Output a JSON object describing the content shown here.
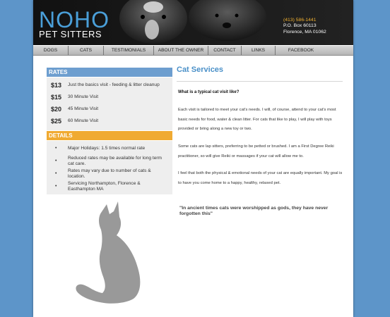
{
  "header": {
    "logo_main": "NOHO",
    "logo_sub": "PET SITTERS",
    "phone": "(413) 586-1441",
    "address_line1": "P.O. Box 60113",
    "address_line2": "Florence, MA 01062"
  },
  "nav": {
    "items": [
      {
        "label": "DOGS"
      },
      {
        "label": "CATS"
      },
      {
        "label": "TESTIMONIALS"
      },
      {
        "label": "ABOUT THE OWNER"
      },
      {
        "label": "CONTACT"
      },
      {
        "label": "LINKS"
      },
      {
        "label": "FACEBOOK"
      }
    ]
  },
  "rates": {
    "heading": "RATES",
    "items": [
      {
        "price": "$13",
        "desc": "Just the basics visit - feeding & litter cleanup"
      },
      {
        "price": "$15",
        "desc": "30 Minute Visit"
      },
      {
        "price": "$20",
        "desc": "45 Minute Visit"
      },
      {
        "price": "$25",
        "desc": "60 Minute Visit"
      }
    ]
  },
  "details": {
    "heading": "DETAILS",
    "bullet": "•",
    "items": [
      {
        "text": "Major Holidays: 1.5 times normal rate"
      },
      {
        "text": "Reduced rates may be available for long term cat care."
      },
      {
        "text": "Rates may vary due to number of cats & location."
      },
      {
        "text": "Servicing Northampton, Florence & Easthampton MA"
      }
    ]
  },
  "main": {
    "title": "Cat Services",
    "question": "What is a typical cat visit like?",
    "paragraphs": [
      "Each visit is tailored to meet your cat's needs. I will, of course, attend to your cat's most basic needs for food, water & clean litter. For cats that like to play, I will play with toys provided or bring along a new toy or two.",
      "Some cats are lap sitters, preferring to be petted or brushed. I am a First Degree Reiki practitioner, so will give Reiki or massages if your cat will allow me to.",
      "I feel that both the physical & emotional needs of your cat are equally important. My goal is to have you come home to a happy, healthy, relaxed pet."
    ],
    "quote": "\"In ancient times cats were worshipped as gods, they have never forgotten this\""
  },
  "colors": {
    "background": "#5d95c9",
    "rates_heading": "#6d9ecf",
    "details_heading": "#f0aa32",
    "title": "#4a90c8"
  },
  "icons": {
    "cat_silhouette": "cat-silhouette-icon"
  }
}
